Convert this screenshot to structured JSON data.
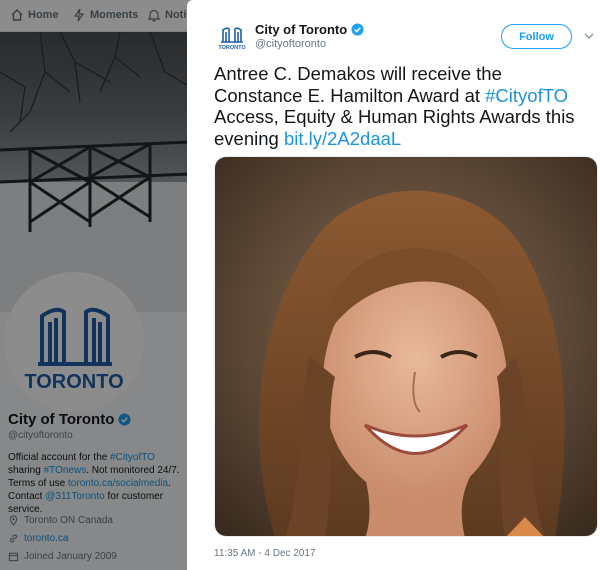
{
  "nav": {
    "items": [
      {
        "label": "Home",
        "icon": "home-icon"
      },
      {
        "label": "Moments",
        "icon": "moments-icon"
      },
      {
        "label": "Notifi",
        "icon": "bell-icon"
      }
    ]
  },
  "profile": {
    "logo_text": "TORONTO",
    "name": "City of Toronto",
    "handle": "@cityoftoronto",
    "bio": {
      "p1": "Official account for the ",
      "tag1": "#CityofTO",
      "p2": " sharing ",
      "tag2": "#TOnews",
      "p3": ". Not monitored 24/7. Terms of use ",
      "link1": "toronto.ca/socialmedia",
      "p4": ". Contact ",
      "link2": "@311Toronto",
      "p5": " for customer service."
    },
    "location": "Toronto ON Canada",
    "website": "toronto.ca",
    "joined": "Joined January 2009"
  },
  "tweet": {
    "logo_text": "TORONTO",
    "author_name": "City of Toronto",
    "author_handle": "@cityoftoronto",
    "follow_label": "Follow",
    "text": {
      "t1": "Antree C. Demakos will receive the Constance E. Hamilton Award at ",
      "hashtag": "#CityofTO",
      "t2": " Access, Equity & Human Rights Awards this evening ",
      "link": "bit.ly/2A2daaL"
    },
    "timestamp": "11:35 AM - 4 Dec 2017"
  },
  "colors": {
    "accent": "#1da1f2",
    "link": "#1b95e0",
    "toronto_blue": "#1f5ea8",
    "verified": "#1da1f2"
  }
}
